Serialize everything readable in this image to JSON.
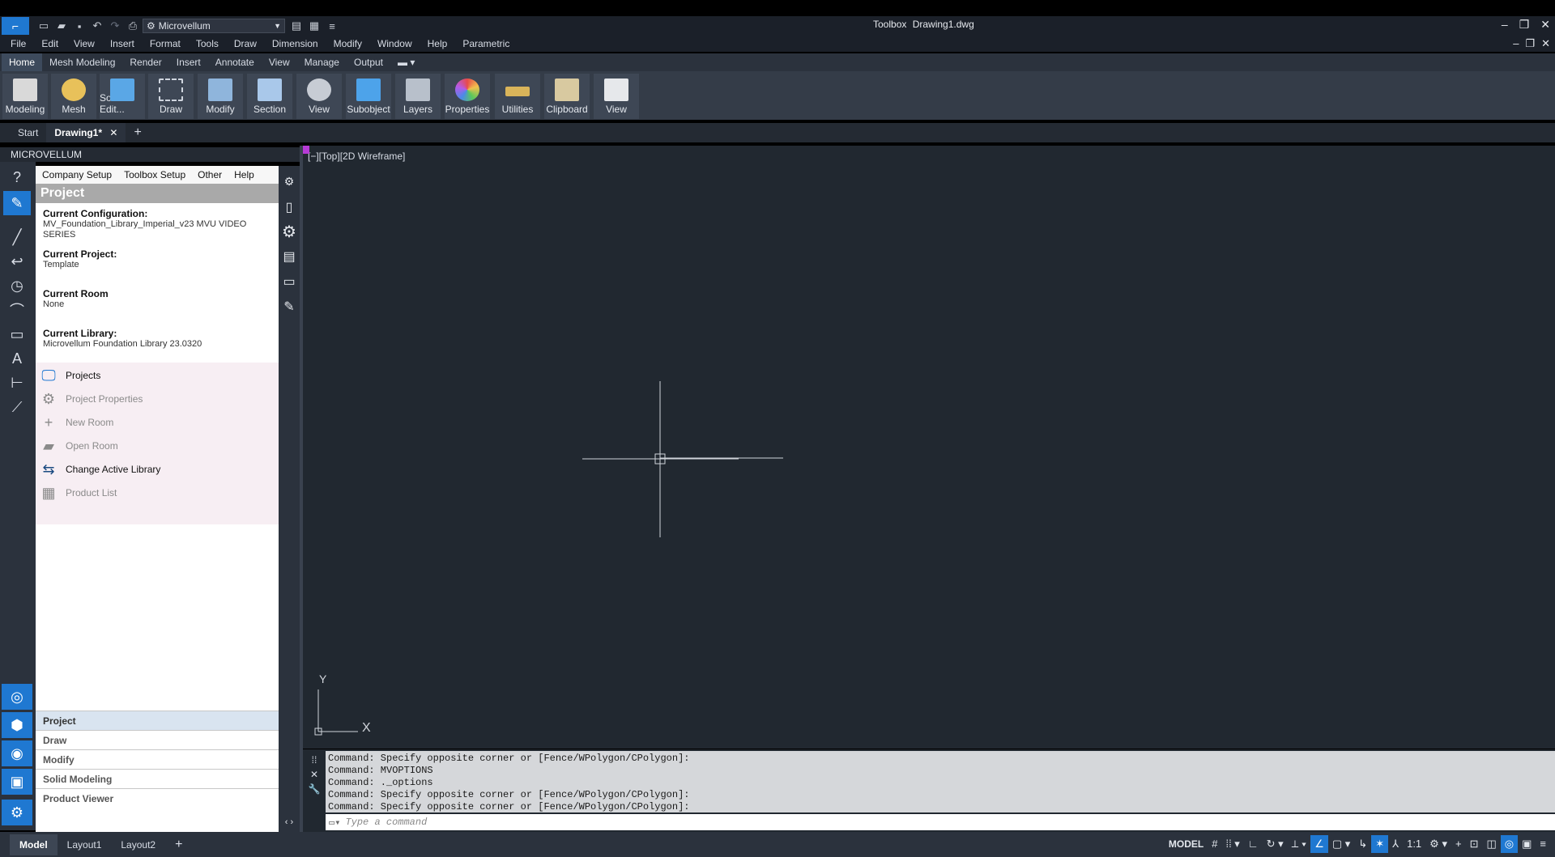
{
  "window": {
    "workspace": "Microvellum",
    "title_app": "Toolbox",
    "title_file": "Drawing1.dwg"
  },
  "qat_icons": [
    "new-icon",
    "open-icon",
    "save-icon",
    "undo-icon",
    "redo-icon",
    "plot-icon",
    "gear-icon"
  ],
  "menu": [
    "File",
    "Edit",
    "View",
    "Insert",
    "Format",
    "Tools",
    "Draw",
    "Dimension",
    "Modify",
    "Window",
    "Help",
    "Parametric"
  ],
  "ribbon_tabs": [
    "Home",
    "Mesh Modeling",
    "Render",
    "Insert",
    "Annotate",
    "View",
    "Manage",
    "Output"
  ],
  "ribbon_buttons": [
    "Modeling",
    "Mesh",
    "Solid Edit...",
    "Draw",
    "Modify",
    "Section",
    "View",
    "Subobject",
    "Layers",
    "Properties",
    "Utilities",
    "Clipboard",
    "View"
  ],
  "doc_tabs": {
    "start": "Start",
    "active": "Drawing1*"
  },
  "palette_title": "MICROVELLUM",
  "panel": {
    "menu": [
      "Company Setup",
      "Toolbox Setup",
      "Other",
      "Help"
    ],
    "title": "Project",
    "config_label": "Current Configuration:",
    "config_value": "MV_Foundation_Library_Imperial_v23 MVU VIDEO SERIES",
    "project_label": "Current Project:",
    "project_value": "Template",
    "room_label": "Current Room",
    "room_value": "None",
    "library_label": "Current Library:",
    "library_value": "Microvellum Foundation Library 23.0320",
    "actions": [
      {
        "label": "Projects",
        "enabled": true
      },
      {
        "label": "Project Properties",
        "enabled": false
      },
      {
        "label": "New Room",
        "enabled": false
      },
      {
        "label": "Open Room",
        "enabled": false
      },
      {
        "label": "Change Active Library",
        "enabled": true
      },
      {
        "label": "Product List",
        "enabled": false
      }
    ],
    "bottom_tabs": [
      "Project",
      "Draw",
      "Modify",
      "Solid Modeling",
      "Product Viewer"
    ]
  },
  "viewport": {
    "label": "[−][Top][2D Wireframe]",
    "ucs_x": "X",
    "ucs_y": "Y"
  },
  "command": {
    "history": [
      "Command: Specify opposite corner or [Fence/WPolygon/CPolygon]:",
      "Command: MVOPTIONS",
      "Command: ._options",
      "Command: Specify opposite corner or [Fence/WPolygon/CPolygon]:",
      "Command: Specify opposite corner or [Fence/WPolygon/CPolygon]:"
    ],
    "placeholder": "Type a command"
  },
  "layout_tabs": [
    "Model",
    "Layout1",
    "Layout2"
  ],
  "status": {
    "model": "MODEL",
    "scale": "1:1"
  },
  "colors": {
    "accent": "#1f78d1",
    "viewport_bg": "#212830"
  }
}
